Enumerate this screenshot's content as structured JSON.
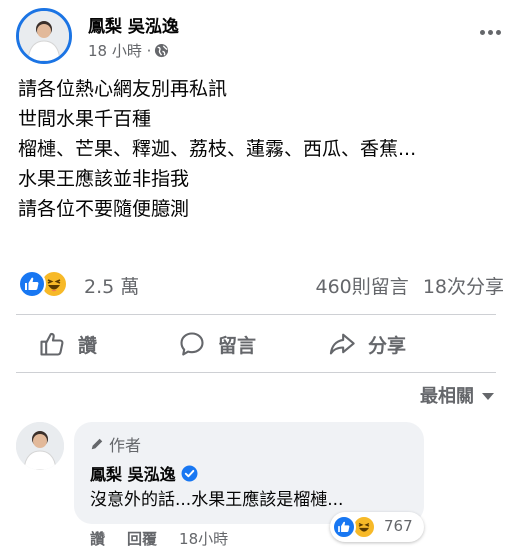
{
  "post": {
    "author": "鳳梨 吳泓逸",
    "time": "18 小時 ·",
    "lines": [
      "請各位熱心網友別再私訊",
      "世間水果千百種",
      "榴槤、芒果、釋迦、荔枝、蓮霧、西瓜、香蕉...",
      "水果王應該並非指我",
      "請各位不要隨便臆測"
    ]
  },
  "reactions": {
    "count": "2.5 萬",
    "comments": "460則留言",
    "shares": "18次分享"
  },
  "actions": {
    "like": "讚",
    "comment": "留言",
    "share": "分享"
  },
  "sort": {
    "label": "最相關"
  },
  "comment": {
    "author_badge": "作者",
    "author": "鳳梨 吳泓逸",
    "text": "沒意外的話...水果王應該是榴槤...",
    "reaction_count": "767",
    "like": "讚",
    "reply": "回覆",
    "time": "18小時"
  },
  "colors": {
    "accent": "#1877f2",
    "haha": "#f7b928",
    "secondary_text": "#65676b",
    "bubble": "#f0f2f5"
  }
}
